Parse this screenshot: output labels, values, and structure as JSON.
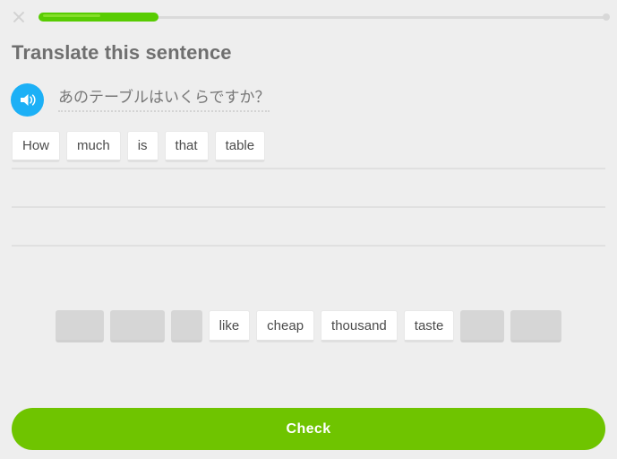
{
  "theme": {
    "background": "#eeeeee",
    "progress_green": "#58cc02",
    "progress_sheen": "#8ce02f",
    "speaker_blue": "#1cb0f6",
    "check_green": "#6fc400",
    "text_gray": "#6f6f6f",
    "tile_text": "#4b4b4b",
    "used_tile_gray": "#d6d6d6"
  },
  "topbar": {
    "close_icon": "close-icon",
    "progress_percent": 21
  },
  "header": {
    "title": "Translate this sentence"
  },
  "prompt": {
    "speaker_icon": "speaker-icon",
    "sentence": "あのテーブルはいくらですか？"
  },
  "answer": {
    "lines": [
      [
        "How",
        "much",
        "is",
        "that",
        "table"
      ],
      [],
      []
    ]
  },
  "wordbank": {
    "tiles": [
      {
        "label": "How",
        "used": true
      },
      {
        "label": "much",
        "used": true
      },
      {
        "label": "is",
        "used": true
      },
      {
        "label": "like",
        "used": false
      },
      {
        "label": "cheap",
        "used": false
      },
      {
        "label": "thousand",
        "used": false
      },
      {
        "label": "taste",
        "used": false
      },
      {
        "label": "that",
        "used": true
      },
      {
        "label": "table",
        "used": true
      }
    ]
  },
  "footer": {
    "check_label": "Check"
  }
}
